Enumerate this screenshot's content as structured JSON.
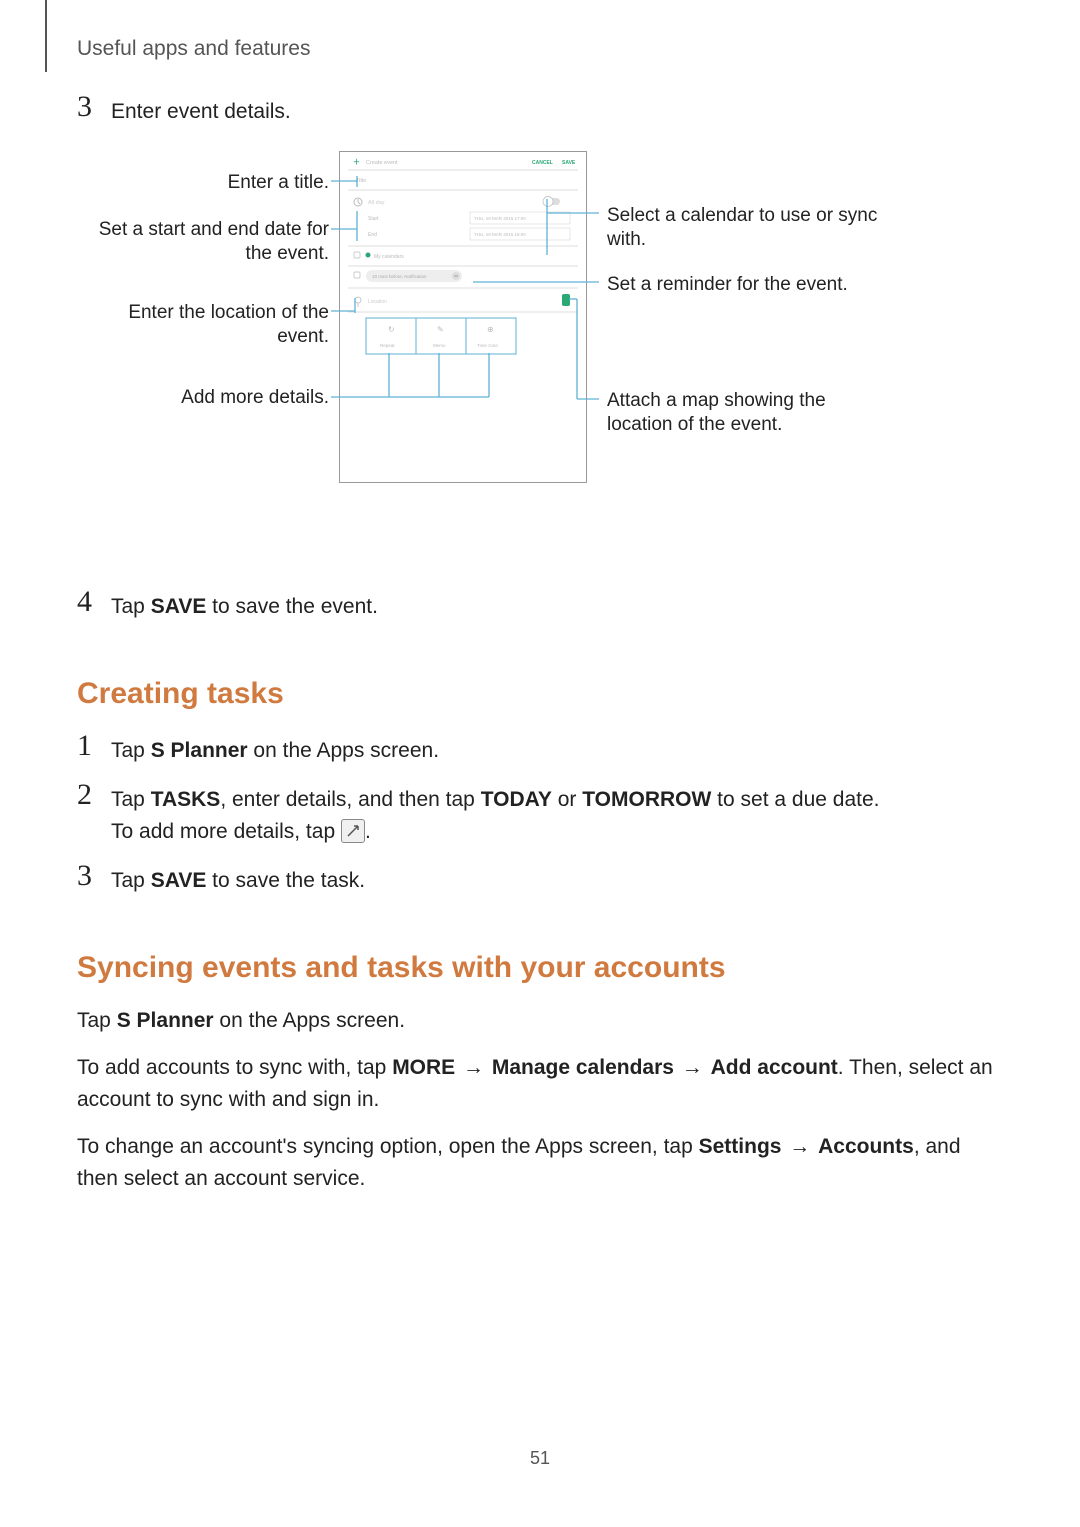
{
  "breadcrumb": "Useful apps and features",
  "steps_top": {
    "s3_num": "3",
    "s3_text": "Enter event details.",
    "s4_num": "4",
    "s4_text_pre": "Tap ",
    "s4_bold": "SAVE",
    "s4_text_post": " to save the event."
  },
  "callouts": {
    "title": "Enter a title.",
    "dates": "Set a start and end date for the event.",
    "location": "Enter the location of the event.",
    "add_more": "Add more details.",
    "calendar": "Select a calendar to use or sync with.",
    "reminder": "Set a reminder for the event.",
    "map": "Attach a map showing the location of the event."
  },
  "phone_ui": {
    "header_create": "Create event",
    "header_cancel": "CANCEL",
    "header_save": "SAVE",
    "title_placeholder": "Title",
    "all_day": "All day",
    "start_label": "Start",
    "end_label": "End",
    "date1": "THU, 19 MAR 2015   17:00",
    "date2": "THU, 19 MAR 2015   18:00",
    "calendar_name": "My calendars",
    "reminder_chip": "10 mins before, Notification",
    "location_placeholder": "Location",
    "btn_repeat": "Repeat",
    "btn_memo": "Memo",
    "btn_timezone": "Time zone"
  },
  "section_tasks": {
    "heading": "Creating tasks",
    "s1_num": "1",
    "s1_pre": "Tap ",
    "s1_bold": "S Planner",
    "s1_post": " on the Apps screen.",
    "s2_num": "2",
    "s2_line1_a": "Tap ",
    "s2_line1_b": "TASKS",
    "s2_line1_c": ", enter details, and then tap ",
    "s2_line1_d": "TODAY",
    "s2_line1_e": " or ",
    "s2_line1_f": "TOMORROW",
    "s2_line1_g": " to set a due date.",
    "s2_line2_a": "To add more details, tap ",
    "s2_line2_b": ".",
    "s3_num": "3",
    "s3_pre": "Tap ",
    "s3_bold": "SAVE",
    "s3_post": " to save the task."
  },
  "section_sync": {
    "heading": "Syncing events and tasks with your accounts",
    "p1_a": "Tap ",
    "p1_b": "S Planner",
    "p1_c": " on the Apps screen.",
    "p2_a": "To add accounts to sync with, tap ",
    "p2_b": "MORE",
    "p2_arrow1": " → ",
    "p2_c": "Manage calendars",
    "p2_arrow2": " → ",
    "p2_d": "Add account",
    "p2_e": ". Then, select an account to sync with and sign in.",
    "p3_a": "To change an account's syncing option, open the Apps screen, tap ",
    "p3_b": "Settings",
    "p3_arrow": " → ",
    "p3_c": "Accounts",
    "p3_d": ", and then select an account service."
  },
  "page_number": "51"
}
